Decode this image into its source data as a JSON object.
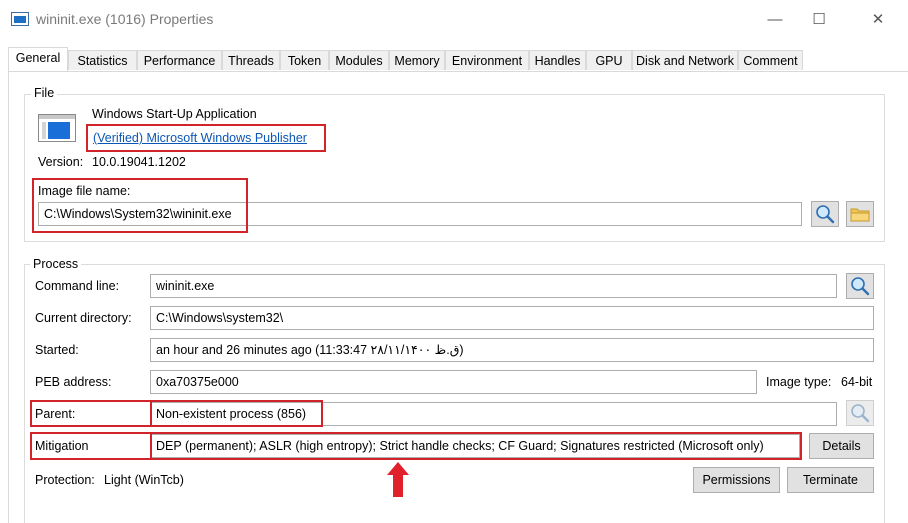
{
  "window": {
    "title": "wininit.exe (1016) Properties",
    "minimize": "—",
    "maximize": "☐",
    "close": "✕"
  },
  "tabs": [
    {
      "label": "General",
      "active": true
    },
    {
      "label": "Statistics"
    },
    {
      "label": "Performance"
    },
    {
      "label": "Threads"
    },
    {
      "label": "Token"
    },
    {
      "label": "Modules"
    },
    {
      "label": "Memory"
    },
    {
      "label": "Environment"
    },
    {
      "label": "Handles"
    },
    {
      "label": "GPU"
    },
    {
      "label": "Disk and Network"
    },
    {
      "label": "Comment"
    }
  ],
  "file": {
    "legend": "File",
    "description": "Windows Start-Up Application",
    "publisher": "(Verified) Microsoft Windows Publisher",
    "version_label": "Version:",
    "version": "10.0.19041.1202",
    "image_label": "Image file name:",
    "image_path": "C:\\Windows\\System32\\wininit.exe"
  },
  "process": {
    "legend": "Process",
    "command_line_label": "Command line:",
    "command_line": "wininit.exe",
    "current_dir_label": "Current directory:",
    "current_dir": "C:\\Windows\\system32\\",
    "started_label": "Started:",
    "started": "an hour and 26 minutes ago (11:33:47 ق.ظ ۲۸/۱۱/۱۴۰۰)",
    "peb_label": "PEB address:",
    "peb": "0xa70375e000",
    "image_type_label": "Image type:",
    "image_type": "64-bit",
    "parent_label": "Parent:",
    "parent": "Non-existent process (856)",
    "mitigation_label": "Mitigation",
    "mitigation": "DEP (permanent); ASLR (high entropy); Strict handle checks; CF Guard; Signatures restricted (Microsoft only)",
    "details_button": "Details",
    "protection_label": "Protection:",
    "protection": "Light (WinTcb)",
    "permissions_button": "Permissions",
    "terminate_button": "Terminate"
  },
  "colors": {
    "highlight": "#d0232a",
    "link": "#0b57b5",
    "icon_blue": "#1a6ed8"
  }
}
